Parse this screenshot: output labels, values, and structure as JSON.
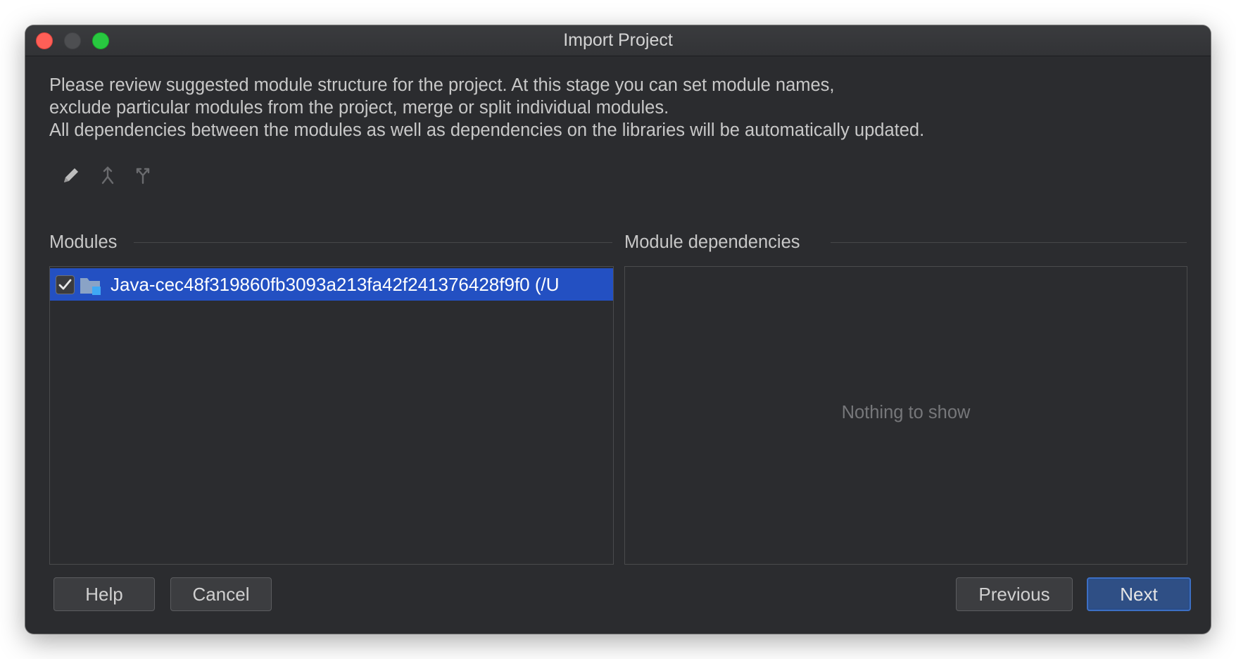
{
  "window": {
    "title": "Import Project"
  },
  "description": {
    "lines": [
      "Please review suggested module structure for the project. At this stage you can set module names,",
      "exclude particular modules from the project, merge or split individual modules.",
      "All dependencies between the modules as well as dependencies on the libraries will be automatically updated."
    ]
  },
  "toolbar": {
    "icons": [
      "pencil-icon",
      "merge-icon",
      "split-icon"
    ]
  },
  "modules": {
    "label": "Modules",
    "items": [
      {
        "checked": true,
        "icon": "module-folder-icon",
        "name": "Java-cec48f319860fb3093a213fa42f241376428f9f0 (/U",
        "selected": true
      }
    ]
  },
  "dependencies": {
    "label": "Module dependencies",
    "empty_text": "Nothing to show"
  },
  "buttons": {
    "help": "Help",
    "cancel": "Cancel",
    "previous": "Previous",
    "next": "Next"
  },
  "colors": {
    "window_bg": "#2b2c2f",
    "selection": "#2350c2",
    "default_button": "#2f4f85",
    "close": "#fe5f57",
    "maximize": "#28c840"
  }
}
